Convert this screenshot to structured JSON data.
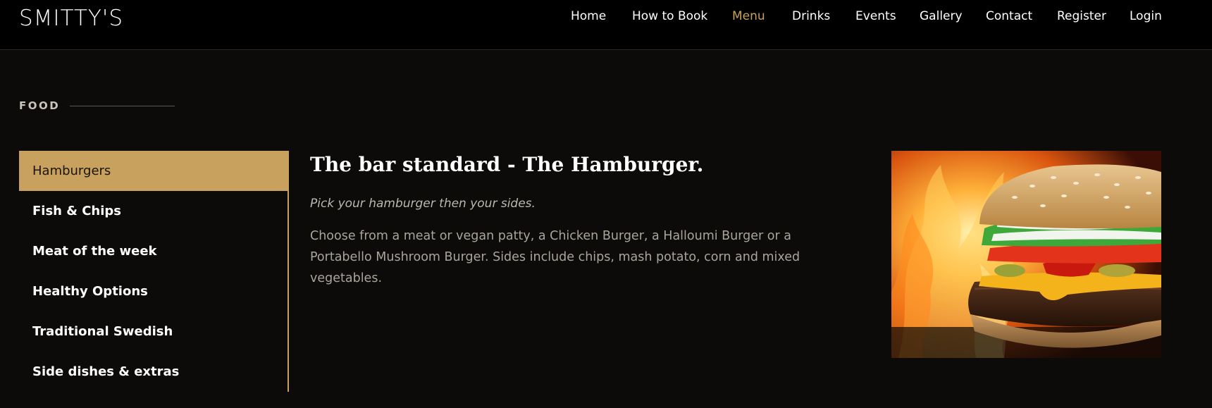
{
  "header": {
    "brand": "SMITTY'S",
    "nav": [
      {
        "label": "Home"
      },
      {
        "label": "How to Book"
      },
      {
        "label": "Menu",
        "active": true
      },
      {
        "label": "Drinks"
      },
      {
        "label": "Events"
      },
      {
        "label": "Gallery"
      },
      {
        "label": "Contact"
      },
      {
        "label": "Register"
      },
      {
        "label": "Login"
      }
    ]
  },
  "section": {
    "label": "FOOD"
  },
  "sidebar": {
    "items": [
      {
        "label": "Hamburgers",
        "active": true
      },
      {
        "label": "Fish & Chips"
      },
      {
        "label": "Meat of the week"
      },
      {
        "label": "Healthy Options"
      },
      {
        "label": "Traditional Swedish"
      },
      {
        "label": "Side dishes & extras"
      }
    ]
  },
  "content": {
    "title": "The bar standard - The Hamburger.",
    "subtitle": "Pick your hamburger then your sides.",
    "description": "Choose from a meat or vegan patty, a Chicken Burger, a Halloumi Burger or a Portabello Mushroom Burger. Sides include chips, mash potato, corn and mixed vegetables."
  },
  "colors": {
    "accent": "#c9a15f",
    "background": "#0c0b09",
    "header_bg": "#000000"
  }
}
